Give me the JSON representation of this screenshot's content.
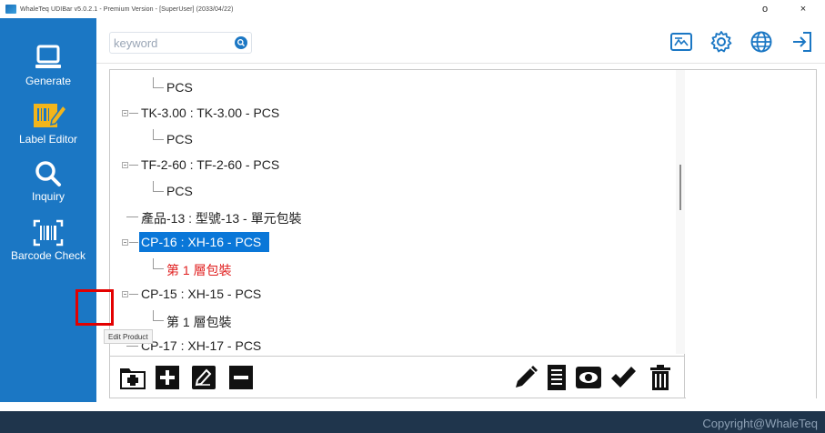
{
  "window": {
    "title": "WhaleTeq UDIBar v5.0.2.1 - Premium Version - [SuperUser] (2033/04/22)",
    "minimize_label": "o",
    "close_label": "×"
  },
  "sidebar": {
    "items": [
      {
        "label": "Generate",
        "icon": "laptop-icon"
      },
      {
        "label": "Label Editor",
        "icon": "label-editor-icon"
      },
      {
        "label": "Inquiry",
        "icon": "search-icon"
      },
      {
        "label": "Barcode Check",
        "icon": "barcode-icon"
      }
    ]
  },
  "search": {
    "placeholder": "keyword",
    "value": ""
  },
  "topbar": {
    "icons": [
      "id-card-icon",
      "gear-icon",
      "globe-icon",
      "logout-icon"
    ]
  },
  "tree": {
    "nodes": [
      {
        "text": "PCS",
        "level": 1,
        "expander": false,
        "selected": false,
        "red": false
      },
      {
        "text": "TK-3.00 : TK-3.00 - PCS",
        "level": 0,
        "expander": true,
        "selected": false,
        "red": false
      },
      {
        "text": "PCS",
        "level": 1,
        "expander": false,
        "selected": false,
        "red": false
      },
      {
        "text": "TF-2-60 : TF-2-60 - PCS",
        "level": 0,
        "expander": true,
        "selected": false,
        "red": false
      },
      {
        "text": "PCS",
        "level": 1,
        "expander": false,
        "selected": false,
        "red": false
      },
      {
        "text": "產品-13 : 型號-13 - 單元包裝",
        "level": 0,
        "expander": false,
        "selected": false,
        "red": false
      },
      {
        "text": "CP-16 : XH-16 - PCS",
        "level": 0,
        "expander": true,
        "selected": true,
        "red": false
      },
      {
        "text": "第 1 層包裝",
        "level": 1,
        "expander": false,
        "selected": false,
        "red": true
      },
      {
        "text": "CP-15 : XH-15 - PCS",
        "level": 0,
        "expander": true,
        "selected": false,
        "red": false
      },
      {
        "text": "第 1 層包裝",
        "level": 1,
        "expander": false,
        "selected": false,
        "red": false
      },
      {
        "text": "CP-17 : XH-17 - PCS",
        "level": 0,
        "expander": false,
        "selected": false,
        "red": false
      }
    ]
  },
  "toolbar": {
    "left_buttons": [
      "add-folder-icon",
      "add-icon",
      "edit-product-icon",
      "remove-icon"
    ],
    "right_buttons": [
      "pencil-icon",
      "document-icon",
      "eye-icon",
      "checkmark-icon",
      "trash-icon"
    ],
    "tooltip": "Edit Product"
  },
  "footer": {
    "copyright": "Copyright@WhaleTeq"
  },
  "colors": {
    "sidebar": "#1b77c4",
    "selection": "#0a77d8",
    "footer": "#1f354c",
    "accent_yellow": "#f2b51b",
    "highlight_red": "#e30000"
  }
}
